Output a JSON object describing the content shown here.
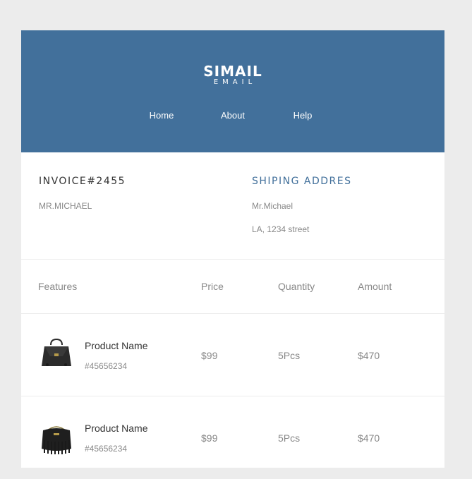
{
  "header": {
    "logo_main": "SIMAIL",
    "logo_sub": "EMAIL",
    "nav": [
      "Home",
      "About",
      "Help"
    ],
    "background_color": "#42709b"
  },
  "invoice": {
    "title": "INVOICE#2455",
    "customer": "MR.MICHAEL"
  },
  "shipping": {
    "title": "SHIPING ADDRES",
    "name": "Mr.Michael",
    "street": "LA, 1234 street"
  },
  "table": {
    "headers": [
      "Features",
      "Price",
      "Quantity",
      "Amount"
    ],
    "rows": [
      {
        "name": "Product Name",
        "sku": "#45656234",
        "price": "$99",
        "quantity": "5Pcs",
        "amount": "$470",
        "icon": "handbag-icon"
      },
      {
        "name": "Product Name",
        "sku": "#45656234",
        "price": "$99",
        "quantity": "5Pcs",
        "amount": "$470",
        "icon": "fringe-bag-icon"
      }
    ]
  }
}
